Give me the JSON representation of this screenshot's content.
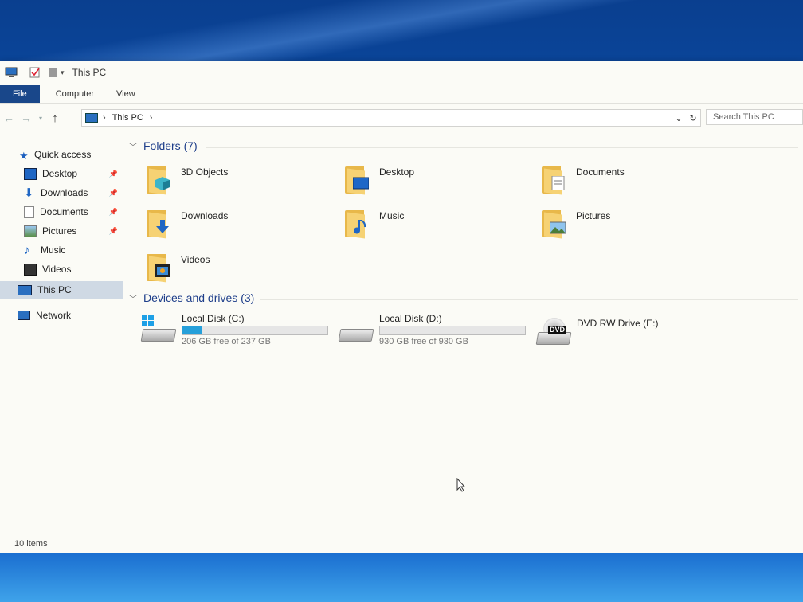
{
  "window": {
    "title": "This PC"
  },
  "ribbon": {
    "tabs": [
      "File",
      "Computer",
      "View"
    ]
  },
  "address": {
    "crumb": "This PC",
    "search_placeholder": "Search This PC"
  },
  "sidebar": {
    "quick_access": "Quick access",
    "items": [
      {
        "label": "Desktop",
        "pinned": true,
        "icon": "desktop-icon"
      },
      {
        "label": "Downloads",
        "pinned": true,
        "icon": "download-icon"
      },
      {
        "label": "Documents",
        "pinned": true,
        "icon": "document-icon"
      },
      {
        "label": "Pictures",
        "pinned": true,
        "icon": "picture-icon"
      },
      {
        "label": "Music",
        "pinned": false,
        "icon": "music-icon"
      },
      {
        "label": "Videos",
        "pinned": false,
        "icon": "video-icon"
      }
    ],
    "this_pc": "This PC",
    "network": "Network"
  },
  "folders": {
    "heading": "Folders (7)",
    "items": [
      {
        "label": "3D Objects",
        "icon": "3d-objects-folder-icon"
      },
      {
        "label": "Desktop",
        "icon": "desktop-folder-icon"
      },
      {
        "label": "Documents",
        "icon": "documents-folder-icon"
      },
      {
        "label": "Downloads",
        "icon": "downloads-folder-icon"
      },
      {
        "label": "Music",
        "icon": "music-folder-icon"
      },
      {
        "label": "Pictures",
        "icon": "pictures-folder-icon"
      },
      {
        "label": "Videos",
        "icon": "videos-folder-icon"
      }
    ]
  },
  "drives": {
    "heading": "Devices and drives (3)",
    "items": [
      {
        "label": "Local Disk (C:)",
        "free": "206 GB free of 237 GB",
        "used_fraction": 0.13,
        "icon": "windows-drive-icon"
      },
      {
        "label": "Local Disk (D:)",
        "free": "930 GB free of 930 GB",
        "used_fraction": 0.0,
        "icon": "hard-drive-icon"
      },
      {
        "label": "DVD RW Drive (E:)",
        "icon": "dvd-drive-icon"
      }
    ]
  },
  "status": {
    "count": "10 items"
  },
  "colors": {
    "accent": "#19478a",
    "progress": "#26a0da",
    "heading": "#1e3e8a"
  }
}
